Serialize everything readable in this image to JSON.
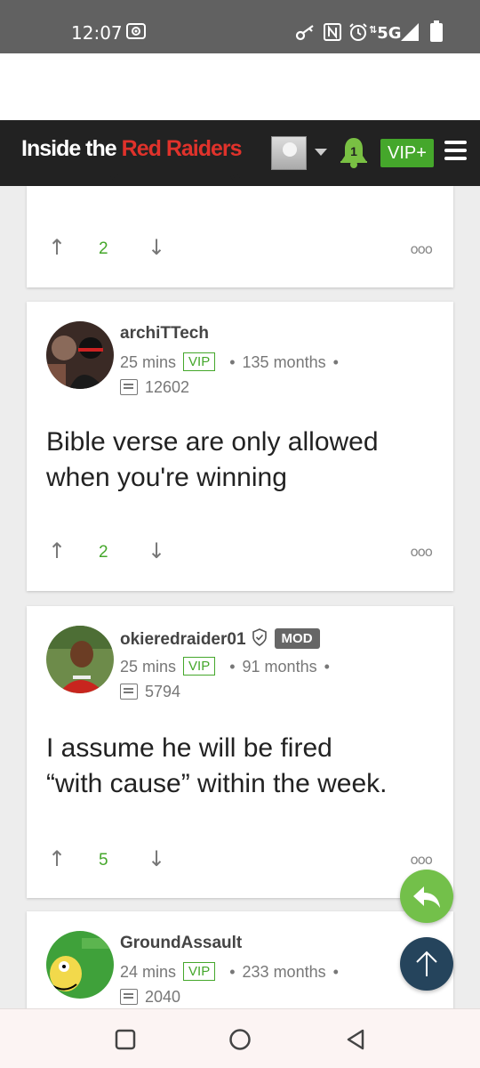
{
  "status_bar": {
    "time": "12:07",
    "network": "5G"
  },
  "header": {
    "logo_white": "Inside the ",
    "logo_red": "Red Raiders",
    "notification_count": "1",
    "vip_label": "VIP+",
    "colors": {
      "header_bg": "#222222",
      "accent_red": "#e0322b",
      "vip_green": "#45a72b"
    }
  },
  "posts": [
    {
      "votes": "2"
    },
    {
      "username": "archiTTech",
      "time_ago": "25 mins",
      "vip_badge": "VIP",
      "member_for": "135 months",
      "post_count": "12602",
      "body_line1": "Bible verse are only allowed",
      "body_line2": "when you're winning",
      "votes": "2"
    },
    {
      "username": "okieredraider01",
      "mod_badge": "MOD",
      "time_ago": "25 mins",
      "vip_badge": "VIP",
      "member_for": "91 months",
      "post_count": "5794",
      "body_line1": "I assume he will be fired",
      "body_line2": "“with cause” within the week.",
      "votes": "5"
    },
    {
      "username": "GroundAssault",
      "time_ago": "24 mins",
      "vip_badge": "VIP",
      "member_for": "233 months",
      "post_count": "2040"
    }
  ],
  "separator_dot": "•",
  "more_glyph": "ooo"
}
